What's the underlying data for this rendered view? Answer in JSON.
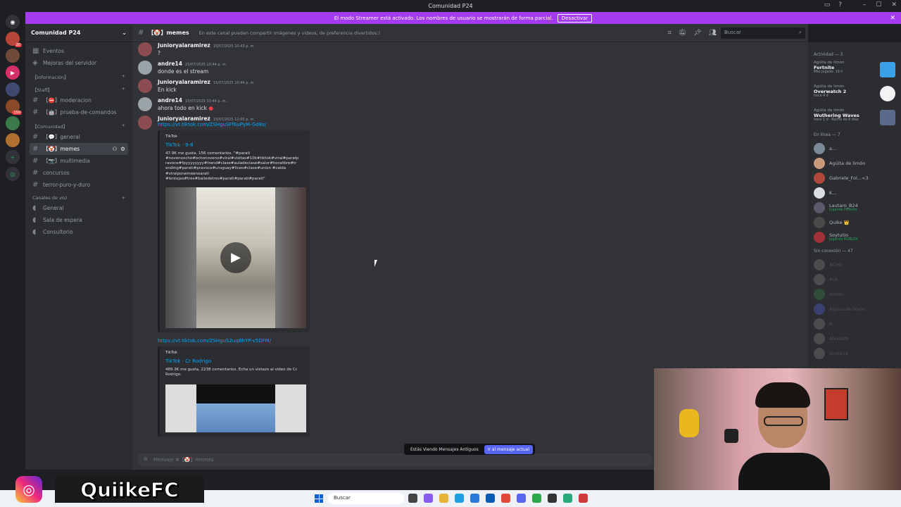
{
  "window": {
    "title": "Comunidad P24"
  },
  "streamer_banner": {
    "text": "El modo Streamer está activado. Los nombres de usuario se mostrarán de forma parcial.",
    "button": "Desactivar"
  },
  "server": {
    "name": "Comunidad P24"
  },
  "sidebar": {
    "top_items": [
      {
        "label": "Eventos"
      },
      {
        "label": "Mejoras del servidor"
      }
    ],
    "categories": [
      {
        "label": "【Información】"
      },
      {
        "label": "【Staff】"
      },
      {
        "label": "【Comunidad】"
      },
      {
        "label": "Canales de voz"
      }
    ],
    "channels": {
      "staff": [
        {
          "label": "【⛔】moderacion"
        },
        {
          "label": "【🤖】prueba-de-comandos"
        }
      ],
      "comunidad": [
        {
          "label": "【💬】general"
        },
        {
          "label": "【🤡】memes"
        },
        {
          "label": "【📷】multimedia"
        },
        {
          "label": "concursos"
        },
        {
          "label": "terror-puro-y-duro"
        }
      ],
      "voice": [
        {
          "label": "General"
        },
        {
          "label": "Sala de espera"
        },
        {
          "label": "Consultorio"
        }
      ]
    }
  },
  "channel_header": {
    "name": "【🤡】memes",
    "topic": "En este canal pueden compartir imágenes y videos, de preferencia divertidos:)",
    "search_placeholder": "Buscar"
  },
  "messages": [
    {
      "author": "Junioryalaramirez",
      "timestamp": "15/07/2025 10:43 p. m.",
      "text": "?"
    },
    {
      "author": "andre14",
      "timestamp": "15/07/2025 10:44 p. m.",
      "text": "donde es el stream"
    },
    {
      "author": "Junioryalaramirez",
      "timestamp": "15/07/2025 10:44 p. m.",
      "text": "En kick"
    },
    {
      "author": "andre14",
      "timestamp": "15/07/2025 10:44 p. m.",
      "text": "ahora todo en kick"
    },
    {
      "author": "Junioryalaramirez",
      "timestamp": "15/07/2025 11:05 p. m.",
      "link": "https://vt.tiktok.com/ZSHguSFf6uPyM-Gd8s/"
    }
  ],
  "embed1": {
    "provider": "TikTok",
    "title": "TikTok · 9-8",
    "description": "47.9K me gusta, 156 comentarios. \"#parati #novenoocho#ochonoveno#viral#visitas#10k#tiktok#viral#paratp ravoce#fpyyyyyyyy#trend#clase#auladeclase#salor#horalibre#tr ending#parati#pravoce#uruguay#liceo#clase#union #caida #viralponemeenoarati #lentejas#tres#bailedetres#parati#parati#parati\""
  },
  "link2": "https://vt.tiktok.com/ZSHguS2uqBhYP-v5DFM/",
  "embed2": {
    "provider": "TikTok",
    "title": "TikTok · Cr Rodrigo",
    "description": "489.3K me gusta, 2238 comentarios. Echa un vistazo al video de Cr Rodrigo."
  },
  "old_messages_bar": {
    "text": "Estás Viendo Mensajes Antiguos",
    "button": "Ir al mensaje actual"
  },
  "composer": {
    "placeholder": "Mensaje #【🤡】memes"
  },
  "members": {
    "activity_header": "Actividad — 3",
    "activities": [
      {
        "user": "Agüita de limón",
        "game": "Fortnite",
        "detail": "Más jugado: 19 h"
      },
      {
        "user": "Agüita de limón",
        "game": "Overwatch 2",
        "detail": "hace 4 d"
      },
      {
        "user": "Agüita de limón",
        "game": "Wuthering Waves",
        "detail": "hace 1 d · Racha de 8 días"
      }
    ],
    "online_header": "En línea — 7",
    "online": [
      {
        "name": "a...",
        "status": ""
      },
      {
        "name": "Agüita de limón",
        "status": ""
      },
      {
        "name": "Gabriele_Fol...<3",
        "status": ""
      },
      {
        "name": "K...",
        "status": ""
      },
      {
        "name": "Lautaro_B24",
        "status": "Jugando Fortnite"
      },
      {
        "name": "Quike 👑",
        "status": ""
      },
      {
        "name": "Soytutio",
        "status": "Jugando ROBLOX"
      }
    ],
    "offline_header": "Sin conexión — 47",
    "offline": [
      {
        "name": "ACHO"
      },
      {
        "name": "Aidi"
      },
      {
        "name": "Adrián"
      },
      {
        "name": "Agüita de limón"
      },
      {
        "name": "A..."
      },
      {
        "name": "Alexis88"
      },
      {
        "name": "andre14"
      }
    ]
  },
  "taskbar": {
    "search": "Buscar"
  },
  "brand": {
    "name": "QuiikeFC"
  }
}
